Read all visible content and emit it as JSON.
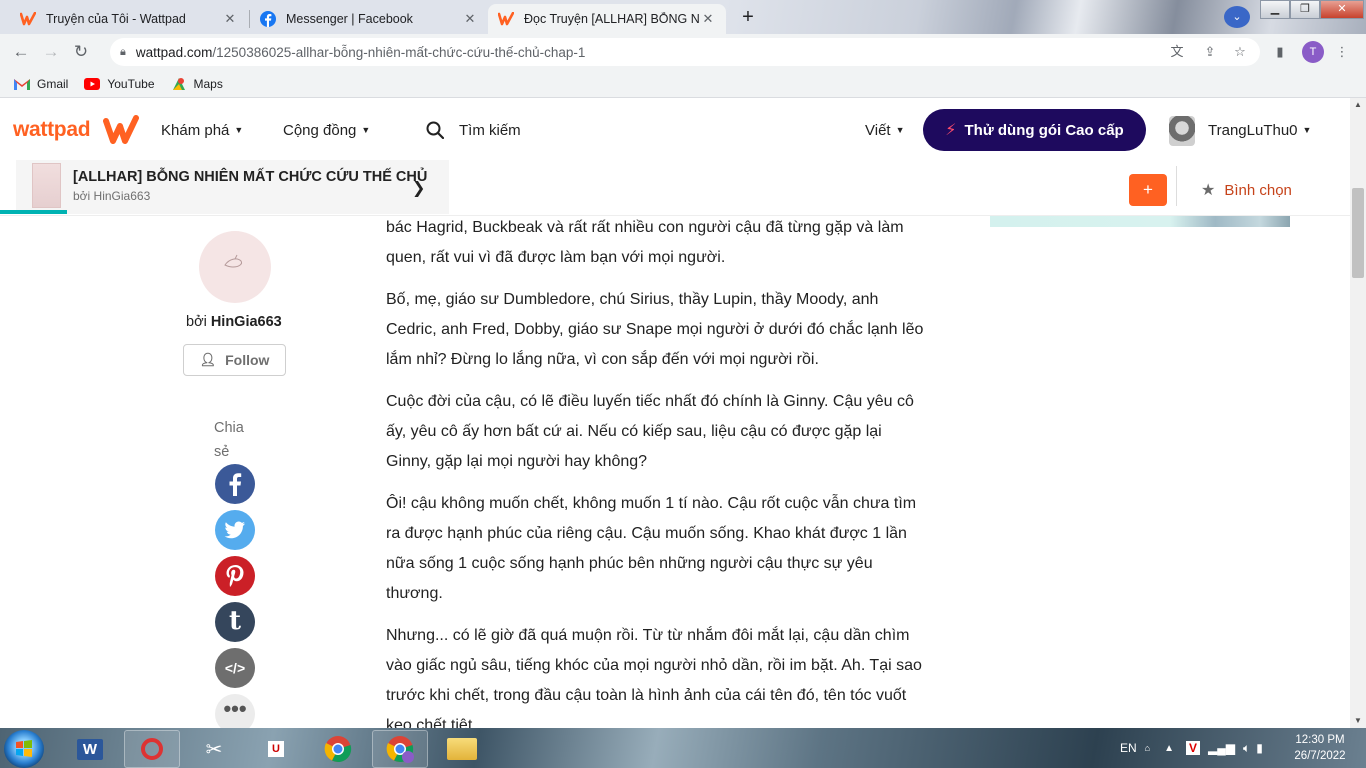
{
  "browser": {
    "tabs": [
      {
        "title": "Truyện của Tôi - Wattpad",
        "active": false
      },
      {
        "title": "Messenger | Facebook",
        "active": false
      },
      {
        "title": "Đọc Truyện [ALLHAR] BỖNG NHI",
        "active": true
      }
    ],
    "url_host": "wattpad.com",
    "url_path": "/1250386025-allhar-bỗng-nhiên-mất-chức-cứu-thế-chủ-chap-1",
    "profile_initial": "T",
    "bookmarks": [
      {
        "label": "Gmail",
        "icon": "gmail-icon"
      },
      {
        "label": "YouTube",
        "icon": "youtube-icon"
      },
      {
        "label": "Maps",
        "icon": "maps-icon"
      }
    ]
  },
  "header": {
    "logo": "wattpad",
    "nav": {
      "explore": "Khám phá",
      "community": "Cộng đồng",
      "search": "Tìm kiếm",
      "write": "Viết"
    },
    "premium_label": "Thử dùng gói Cao cấp",
    "username": "TrangLuThu0"
  },
  "story": {
    "title": "[ALLHAR] BỖNG NHIÊN MẤT CHỨC CỨU THẾ CHỦ",
    "byline": "bởi HinGia663",
    "add_label": "+",
    "vote_label": "Bình chọn",
    "reading_progress": 0.05
  },
  "author": {
    "prefix": "bởi",
    "name": "HinGia663",
    "follow_label": "Follow"
  },
  "share": {
    "label": "Chia sẻ",
    "networks": [
      "facebook-icon",
      "twitter-icon",
      "pinterest-icon",
      "tumblr-icon",
      "embed-icon",
      "more-icon"
    ]
  },
  "paragraphs": [
    "bác Hagrid, Buckbeak và rất rất nhiều con người cậu đã từng gặp và làm quen, rất vui vì đã được làm bạn với mọi người.",
    "Bố, mẹ, giáo sư Dumbledore, chú Sirius, thầy Lupin, thầy Moody, anh Cedric, anh Fred, Dobby, giáo sư Snape mọi người ở dưới đó chắc lạnh lẽo lắm nhỉ? Đừng lo lắng nữa, vì con sắp đến với mọi người rồi.",
    "Cuộc đời của cậu, có lẽ điều luyến tiếc nhất đó chính là Ginny. Cậu yêu cô ấy, yêu cô ấy hơn bất cứ ai. Nếu có kiếp sau, liệu cậu có được gặp lại Ginny, gặp lại mọi người hay không?",
    "Ôi! cậu không muốn chết, không muốn 1 tí nào. Cậu rốt cuộc vẫn chưa tìm ra được hạnh phúc của riêng cậu. Cậu muốn sống. Khao khát được 1 lần nữa sống 1 cuộc sống hạnh phúc bên những người cậu thực sự yêu thương.",
    "Nhưng... có lẽ giờ đã quá muộn rồi. Từ từ nhắm đôi mắt lại, cậu dần chìm vào giấc ngủ sâu, tiếng khóc của mọi người nhỏ dần, rồi im bặt. Ah. Tại sao trước khi chết, trong đầu cậu toàn là hình ảnh của cái tên đó, tên tóc vuốt keo chết tiệt."
  ],
  "taskbar": {
    "language": "EN",
    "time": "12:30 PM",
    "date": "26/7/2022"
  },
  "colors": {
    "wattpad_orange": "#ff6122",
    "premium_bg": "#1e0a5e",
    "progress_teal": "#00b2b2",
    "vote_text": "#c6431a"
  }
}
